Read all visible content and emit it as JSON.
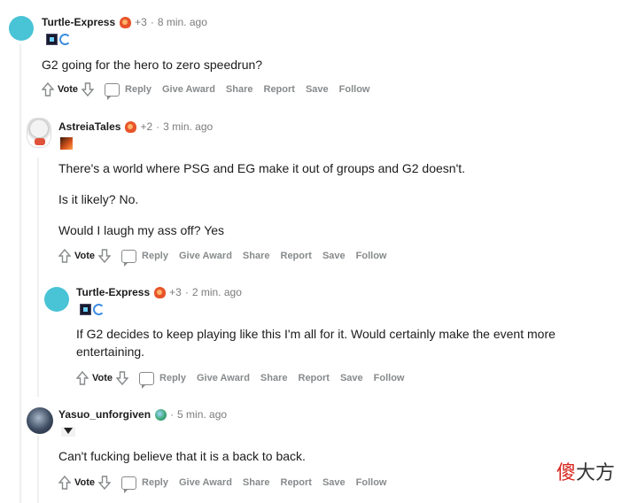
{
  "comments": [
    {
      "username": "Turtle-Express",
      "plus": "+3",
      "time": "8 min. ago",
      "body": [
        "G2 going for the hero to zero speedrun?"
      ]
    },
    {
      "username": "AstreiaTales",
      "plus": "+2",
      "time": "3 min. ago",
      "body": [
        "There's a world where PSG and EG make it out of groups and G2 doesn't.",
        "Is it likely? No.",
        "Would I laugh my ass off? Yes"
      ]
    },
    {
      "username": "Turtle-Express",
      "plus": "+3",
      "time": "2 min. ago",
      "body": [
        "If G2 decides to keep playing like this I'm all for it. Would certainly make the event more entertaining."
      ]
    },
    {
      "username": "Yasuo_unforgiven",
      "plus": "",
      "time": "5 min. ago",
      "body": [
        "Can't fucking believe that it is a back to back."
      ]
    }
  ],
  "actions": {
    "vote": "Vote",
    "reply": "Reply",
    "give_award": "Give Award",
    "share": "Share",
    "report": "Report",
    "save": "Save",
    "follow": "Follow"
  },
  "separator": "·",
  "watermark": {
    "red": "傻",
    "dark": "大方"
  },
  "colors": {
    "turtle_avatar": "#49c3d6",
    "meta_gray": "#7c7c7c",
    "action_gray": "#878a8c",
    "thread_line": "#edeff1"
  }
}
